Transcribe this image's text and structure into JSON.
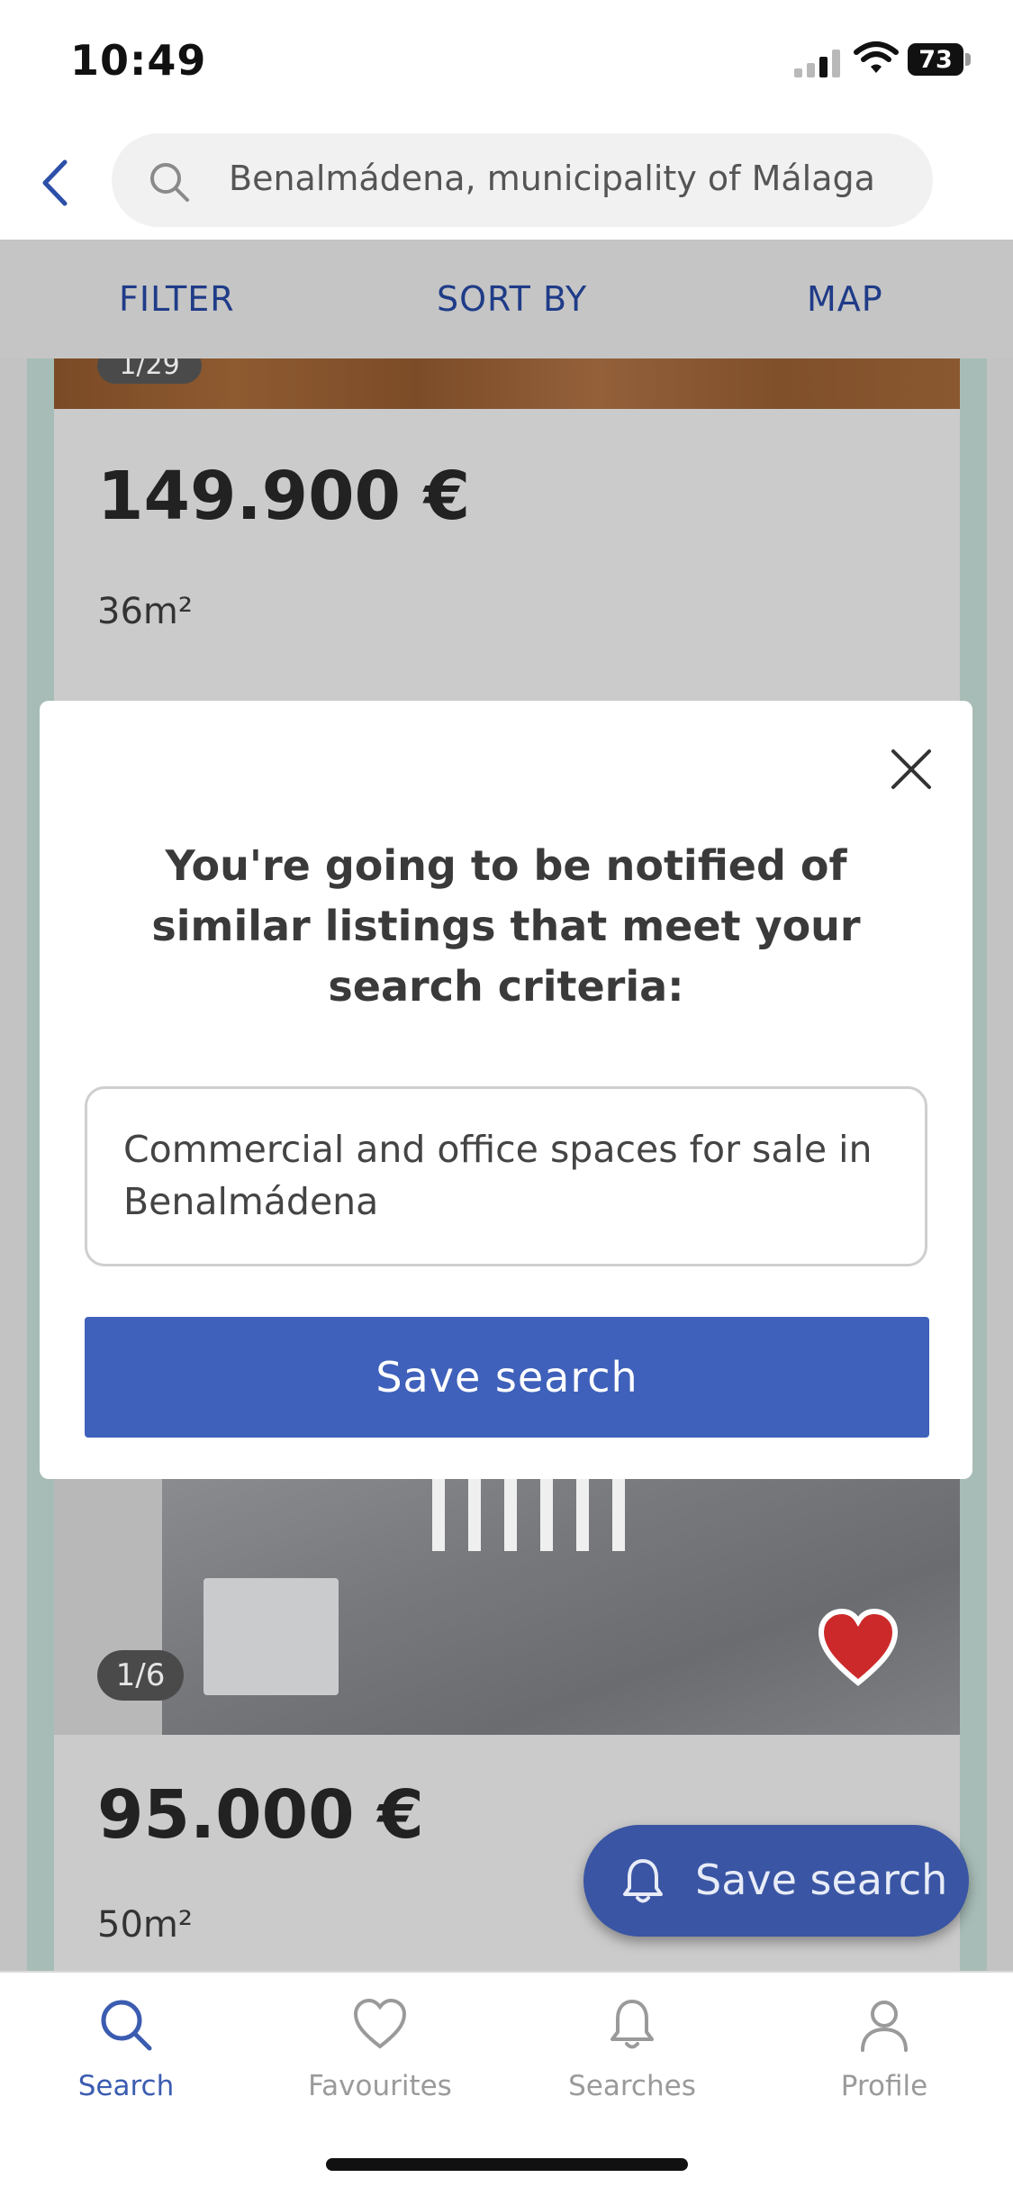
{
  "status_bar": {
    "time": "10:49",
    "battery": "73"
  },
  "header": {
    "search_text": "Benalmádena, municipality of Málaga"
  },
  "filter_bar": {
    "filter_label": "FILTER",
    "sort_label": "SORT BY",
    "map_label": "MAP"
  },
  "listings": [
    {
      "photo_counter": "1/29",
      "price": "149.900 €",
      "size": "36m²"
    },
    {
      "photo_counter": "1/6",
      "price": "95.000 €",
      "size": "50m²"
    }
  ],
  "modal": {
    "title": "You're going to be notified of similar listings that meet your search criteria:",
    "criteria": "Commercial and office spaces for sale in Benalmádena",
    "save_button": "Save search"
  },
  "fab": {
    "label": "Save search"
  },
  "bottom_nav": [
    {
      "label": "Search",
      "icon": "search-icon",
      "active": true
    },
    {
      "label": "Favourites",
      "icon": "heart-icon",
      "active": false
    },
    {
      "label": "Searches",
      "icon": "bell-icon",
      "active": false
    },
    {
      "label": "Profile",
      "icon": "person-icon",
      "active": false
    }
  ],
  "colors": {
    "accent": "#3f61bb",
    "nav_active": "#3b5cb0",
    "filter_text": "#1f3c88",
    "favourite_heart": "#cc2a2a"
  }
}
